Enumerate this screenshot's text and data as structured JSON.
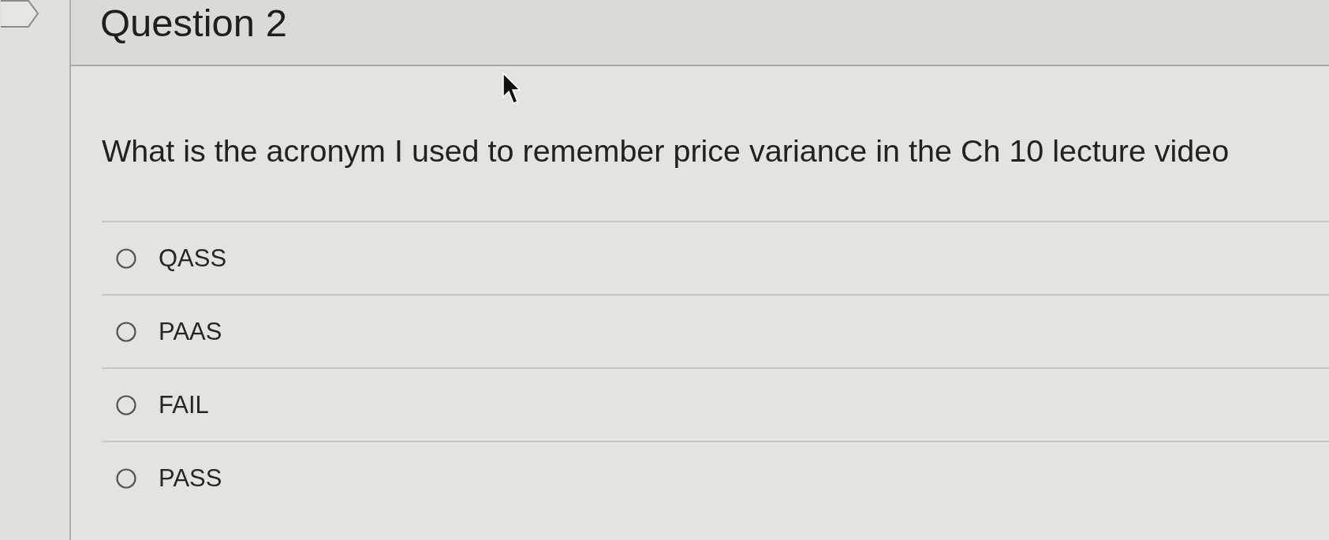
{
  "question": {
    "title": "Question 2",
    "text": "What is the acronym I used to remember price variance in the Ch 10 lecture video"
  },
  "options": [
    {
      "label": "QASS",
      "selected": false
    },
    {
      "label": "PAAS",
      "selected": false
    },
    {
      "label": "FAIL",
      "selected": false
    },
    {
      "label": "PASS",
      "selected": false
    }
  ]
}
